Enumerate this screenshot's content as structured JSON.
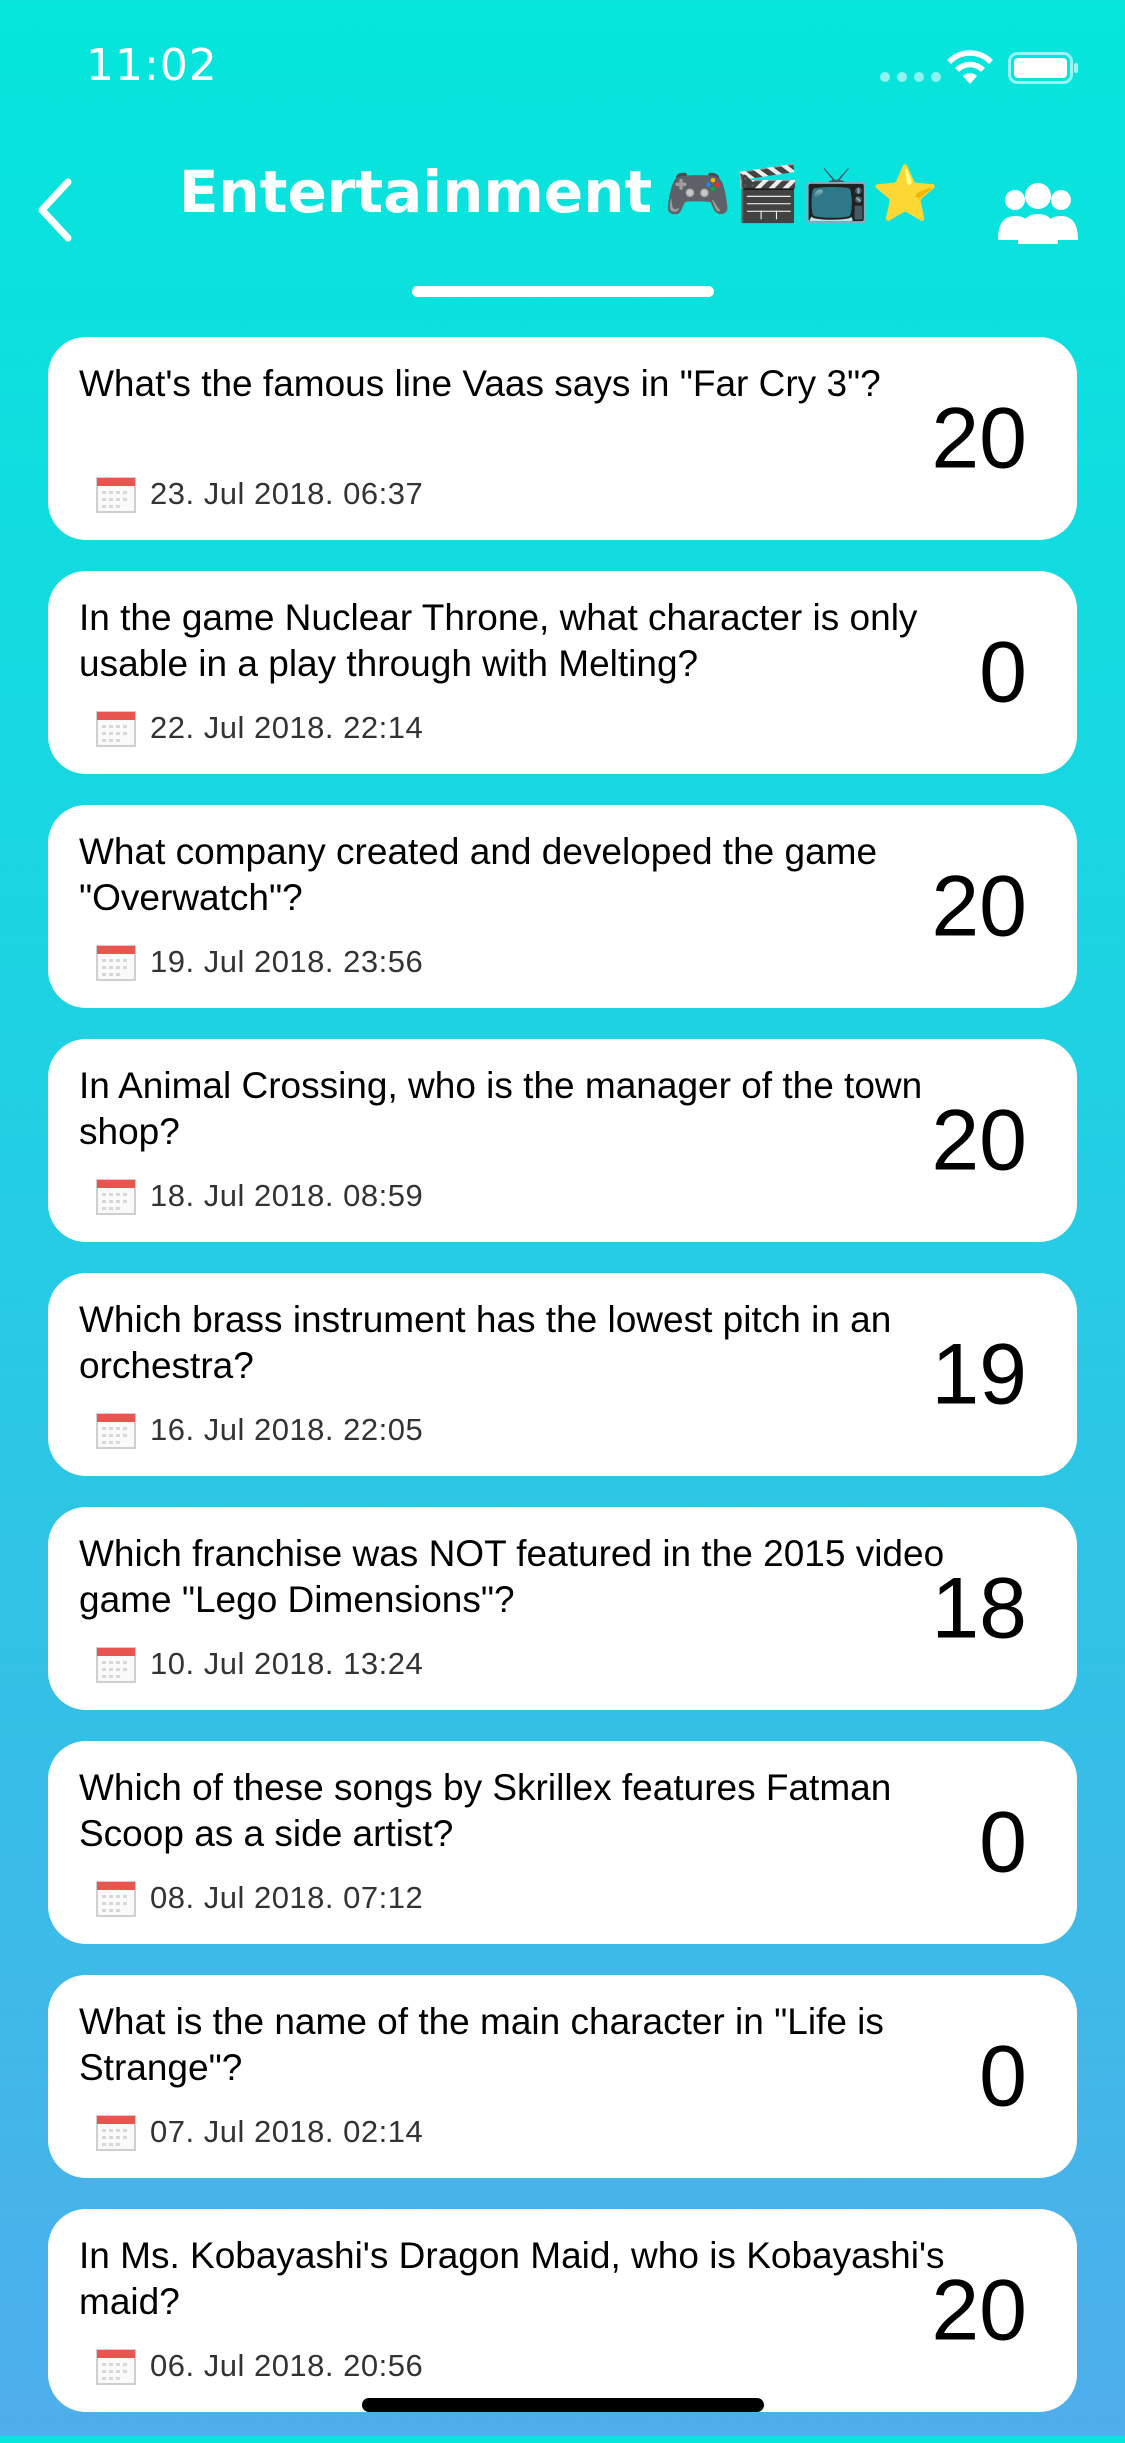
{
  "status_bar": {
    "time": "11:02"
  },
  "nav": {
    "title": "Entertainment",
    "title_emojis": "🎮🎬📺⭐"
  },
  "colors": {
    "background_top": "#05e6dc",
    "background_bottom": "#4faeeb",
    "card_background": "#ffffff",
    "calendar_accent": "#e8554e"
  },
  "icons": {
    "back": "chevron-left-icon",
    "group": "group-users-icon",
    "calendar": "calendar-icon",
    "wifi": "wifi-icon",
    "battery": "battery-icon"
  },
  "questions": [
    {
      "question": "What's the famous line Vaas says in \"Far Cry 3\"?",
      "date": "23. Jul 2018. 06:37",
      "score": "20"
    },
    {
      "question": "In the game Nuclear Throne, what character is only usable in a play through with Melting?",
      "date": "22. Jul 2018. 22:14",
      "score": "0"
    },
    {
      "question": "What company created and developed the game \"Overwatch\"?",
      "date": "19. Jul 2018. 23:56",
      "score": "20"
    },
    {
      "question": "In Animal Crossing, who is the manager of the town shop?",
      "date": "18. Jul 2018. 08:59",
      "score": "20"
    },
    {
      "question": "Which brass instrument has the lowest pitch in an orchestra?",
      "date": "16. Jul 2018. 22:05",
      "score": "19"
    },
    {
      "question": "Which franchise was NOT featured in the 2015 video game \"Lego Dimensions\"?",
      "date": "10. Jul 2018. 13:24",
      "score": "18"
    },
    {
      "question": "Which of these songs by Skrillex features Fatman Scoop as a side artist?",
      "date": "08. Jul 2018. 07:12",
      "score": "0"
    },
    {
      "question": "What is the name of the main character in \"Life is Strange\"?",
      "date": "07. Jul 2018. 02:14",
      "score": "0"
    },
    {
      "question": "In Ms. Kobayashi's Dragon Maid, who is Kobayashi's maid?",
      "date": "06. Jul 2018. 20:56",
      "score": "20"
    }
  ]
}
